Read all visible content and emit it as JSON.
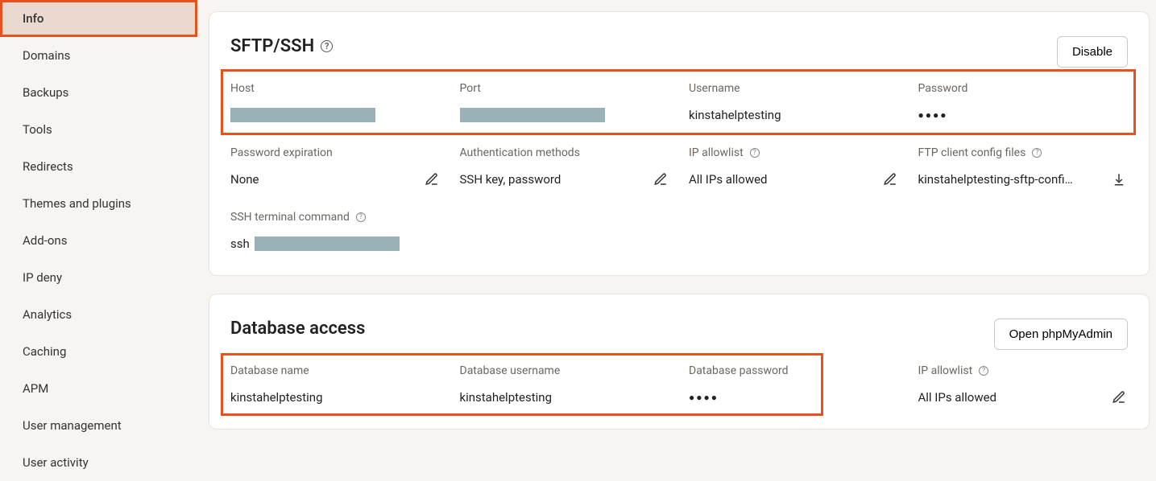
{
  "sidebar": {
    "items": [
      {
        "label": "Info",
        "active": true
      },
      {
        "label": "Domains"
      },
      {
        "label": "Backups"
      },
      {
        "label": "Tools"
      },
      {
        "label": "Redirects"
      },
      {
        "label": "Themes and plugins"
      },
      {
        "label": "Add-ons"
      },
      {
        "label": "IP deny"
      },
      {
        "label": "Analytics"
      },
      {
        "label": "Caching"
      },
      {
        "label": "APM"
      },
      {
        "label": "User management"
      },
      {
        "label": "User activity"
      }
    ]
  },
  "sftp": {
    "title": "SFTP/SSH",
    "disable_label": "Disable",
    "fields": {
      "host_label": "Host",
      "port_label": "Port",
      "username_label": "Username",
      "username_value": "kinstahelptesting",
      "password_label": "Password",
      "password_value": "●●●●",
      "password_expiration_label": "Password expiration",
      "password_expiration_value": "None",
      "auth_methods_label": "Authentication methods",
      "auth_methods_value": "SSH key, password",
      "ip_allowlist_label": "IP allowlist",
      "ip_allowlist_value": "All IPs allowed",
      "ftp_config_label": "FTP client config files",
      "ftp_config_value": "kinstahelptesting-sftp-config....",
      "ssh_command_label": "SSH terminal command",
      "ssh_command_prefix": "ssh"
    }
  },
  "db": {
    "title": "Database access",
    "open_label": "Open phpMyAdmin",
    "fields": {
      "name_label": "Database name",
      "name_value": "kinstahelptesting",
      "user_label": "Database username",
      "user_value": "kinstahelptesting",
      "password_label": "Database password",
      "password_value": "●●●●",
      "ip_allowlist_label": "IP allowlist",
      "ip_allowlist_value": "All IPs allowed"
    }
  }
}
